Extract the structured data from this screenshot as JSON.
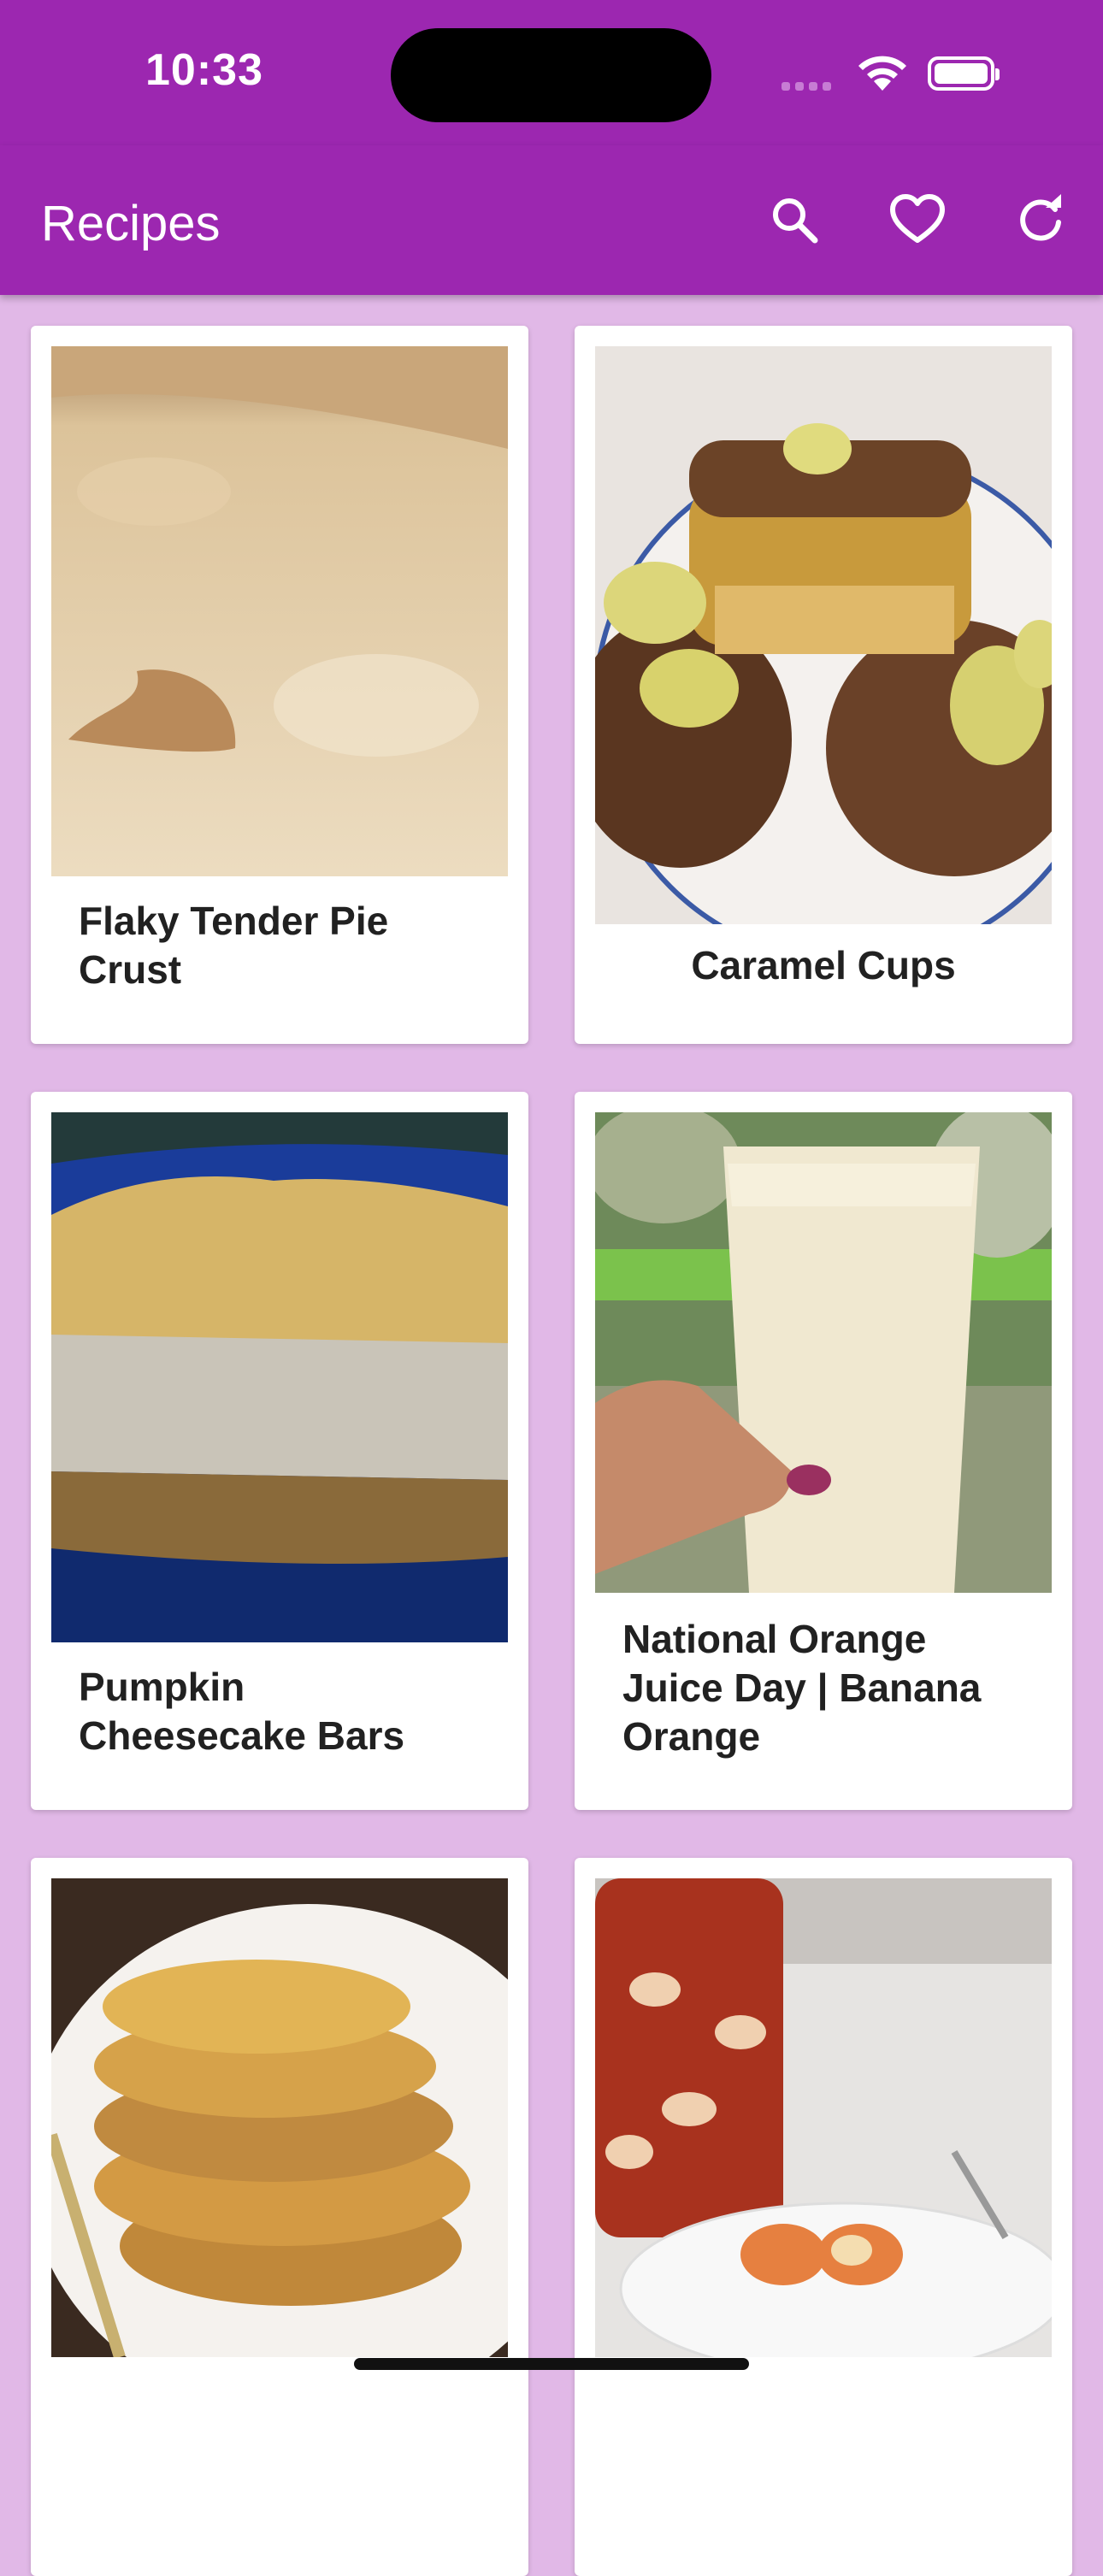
{
  "status": {
    "time": "10:33"
  },
  "app_bar": {
    "title": "Recipes",
    "actions": [
      "search-icon",
      "heart-icon",
      "refresh-icon"
    ]
  },
  "recipes": [
    {
      "title": "Flaky Tender Pie Crust"
    },
    {
      "title": "Caramel Cups"
    },
    {
      "title": "Pumpkin Cheesecake Bars"
    },
    {
      "title": "National Orange Juice Day | Banana Orange"
    },
    {
      "title": ""
    },
    {
      "title": ""
    }
  ],
  "colors": {
    "primary": "#9c27b0",
    "background": "#e1b8e7",
    "card": "#ffffff",
    "text": "#212121"
  }
}
